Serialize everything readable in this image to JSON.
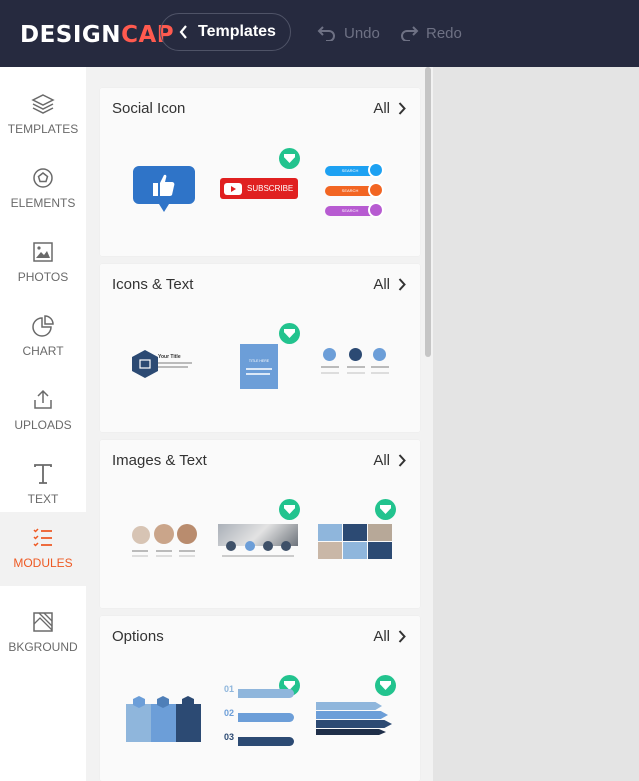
{
  "app": {
    "logo_part1": "DESIGN",
    "logo_part2": "CAP",
    "accent": "#ff5a4f"
  },
  "header": {
    "templates_label": "Templates",
    "undo_label": "Undo",
    "redo_label": "Redo",
    "background": "#262a3f"
  },
  "sidebar": {
    "items": [
      {
        "label": "TEMPLATES",
        "icon": "layers-icon"
      },
      {
        "label": "ELEMENTS",
        "icon": "shapes-icon"
      },
      {
        "label": "PHOTOS",
        "icon": "image-icon"
      },
      {
        "label": "CHART",
        "icon": "pie-chart-icon"
      },
      {
        "label": "UPLOADS",
        "icon": "upload-icon"
      },
      {
        "label": "TEXT",
        "icon": "text-icon"
      },
      {
        "label": "MODULES",
        "icon": "list-icon",
        "active": true
      },
      {
        "label": "BKGROUND",
        "icon": "background-icon"
      }
    ],
    "active_color": "#ee5a24"
  },
  "modules": {
    "all_label": "All",
    "sections": [
      {
        "title": "Social Icon"
      },
      {
        "title": "Icons & Text"
      },
      {
        "title": "Images & Text"
      },
      {
        "title": "Options"
      }
    ]
  },
  "thumbs": {
    "subscribe": "SUBSCRIBE",
    "search": "SEARCH",
    "your_title": "Your Title",
    "title_here": "TITLE HERE",
    "step1": "01",
    "step2": "02",
    "step3": "03"
  },
  "premium_color": "#22c38e"
}
